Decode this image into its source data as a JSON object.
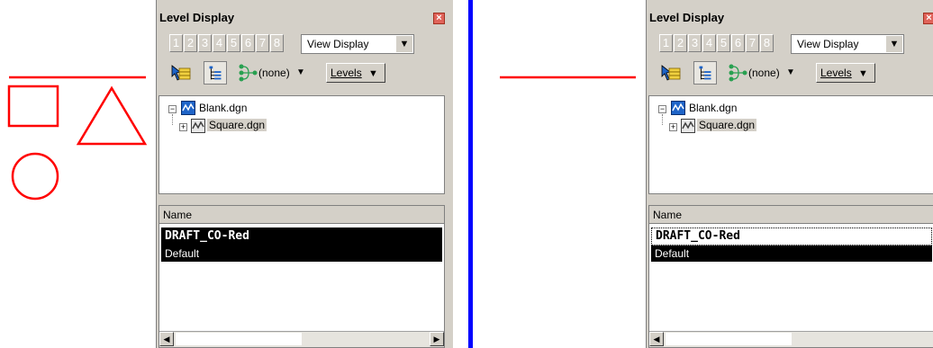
{
  "panel": {
    "title": "Level Display",
    "close_glyph": "×",
    "level_numbers": [
      "1",
      "2",
      "3",
      "4",
      "5",
      "6",
      "7",
      "8"
    ],
    "view_dropdown": "View Display",
    "dropdown_arrow": "▼",
    "filter_label": "(none)",
    "small_arrow": "▼",
    "levels_button": "Levels",
    "tree": [
      {
        "name": "Blank.dgn",
        "expander": "−"
      },
      {
        "name": "Square.dgn",
        "expander": "+"
      }
    ],
    "list_header": "Name",
    "levels": [
      "DRAFT_CO-Red",
      "Default"
    ],
    "scroll_left": "◀",
    "scroll_right": "▶"
  },
  "icons": {
    "level_manager": "folder-select-icon",
    "tree_view": "tree-view-icon",
    "filter": "level-filter-icon"
  },
  "colors": {
    "shape_red": "#ff0000",
    "divider_blue": "#0000ff",
    "dgn_icon_blue": "#1e64c8"
  }
}
